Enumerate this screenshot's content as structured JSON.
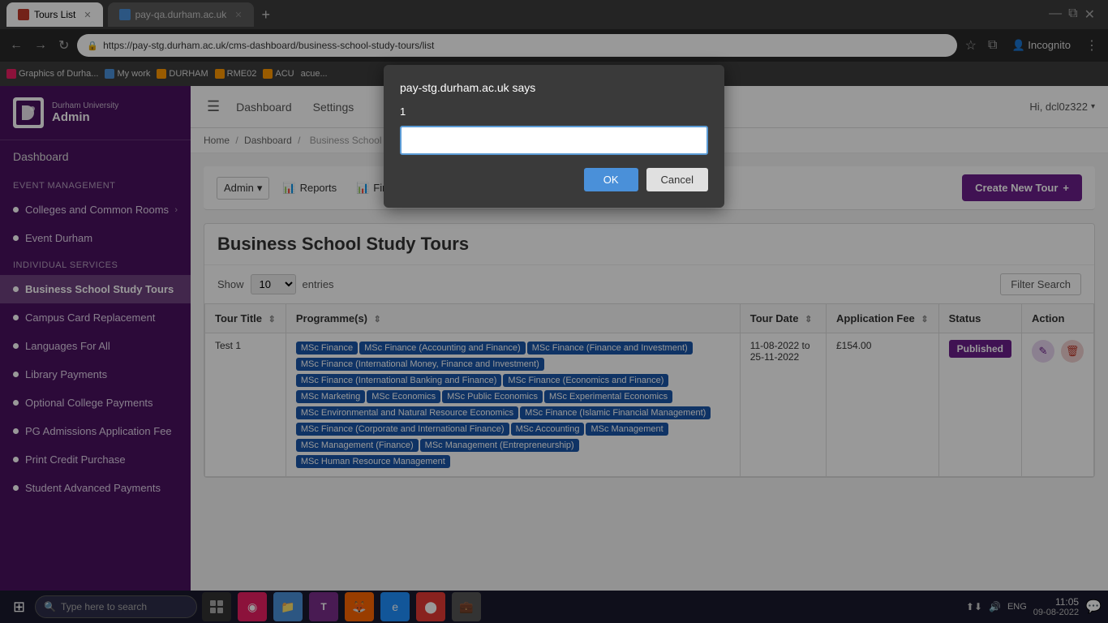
{
  "browser": {
    "tabs": [
      {
        "label": "Tours List",
        "url": "",
        "active": true,
        "favicon_color": "#c0392b"
      },
      {
        "label": "pay-qa.durham.ac.uk",
        "url": "",
        "active": false,
        "favicon_color": "#4a90d9"
      }
    ],
    "address": "https://pay-stg.durham.ac.uk/cms-dashboard/business-school-study-tours/list",
    "bookmarks": [
      {
        "label": "Graphics of Durha...",
        "color": "#e91e63"
      },
      {
        "label": "My work",
        "color": "#4a90d9"
      },
      {
        "label": "DURHAM",
        "color": "#ff9800"
      },
      {
        "label": "RME02",
        "color": "#ff9800"
      },
      {
        "label": "ACU",
        "color": "#ff9800"
      },
      {
        "label": "acue...",
        "color": "#555"
      }
    ],
    "user": "Hi, dcl0z322"
  },
  "sidebar": {
    "logo_text": "Durham University",
    "admin_label": "Admin",
    "dashboard_label": "Dashboard",
    "sections": [
      {
        "header": "EVENT MANAGEMENT",
        "items": [
          {
            "label": "Colleges and Common Rooms",
            "active": false,
            "has_chevron": true
          },
          {
            "label": "Event Durham",
            "active": false,
            "has_chevron": false
          }
        ]
      },
      {
        "header": "INDIVIDUAL SERVICES",
        "items": [
          {
            "label": "Business School Study Tours",
            "active": true,
            "has_chevron": false
          },
          {
            "label": "Campus Card Replacement",
            "active": false,
            "has_chevron": false
          },
          {
            "label": "Languages For All",
            "active": false,
            "has_chevron": false
          },
          {
            "label": "Library Payments",
            "active": false,
            "has_chevron": false
          },
          {
            "label": "Optional College Payments",
            "active": false,
            "has_chevron": false
          },
          {
            "label": "PG Admissions Application Fee",
            "active": false,
            "has_chevron": false
          },
          {
            "label": "Print Credit Purchase",
            "active": false,
            "has_chevron": false
          },
          {
            "label": "Student Advanced Payments",
            "active": false,
            "has_chevron": false
          }
        ]
      }
    ]
  },
  "topbar": {
    "dashboard_label": "Dashboard",
    "settings_label": "Settings",
    "user_label": "Hi, dcl0z322"
  },
  "breadcrumb": {
    "home": "Home",
    "dashboard": "Dashboard",
    "current": "Business School Study Tours"
  },
  "action_bar": {
    "admin_label": "Admin",
    "reports_label": "Reports",
    "financial_label": "Financial Summary Report",
    "create_tour_label": "Create New Tour"
  },
  "table": {
    "title": "Business School Study Tours",
    "show_label": "Show",
    "entries_value": "10",
    "entries_label": "entries",
    "filter_label": "Filter Search",
    "columns": [
      "Tour Title",
      "Programme(s)",
      "Tour Date",
      "Application Fee",
      "Status",
      "Action"
    ],
    "rows": [
      {
        "tour_title": "Test 1",
        "programmes": [
          "MSc Finance",
          "MSc Finance (Accounting and Finance)",
          "MSc Finance (Finance and Investment)",
          "MSc Finance (International Money, Finance and Investment)",
          "MSc Finance (International Banking and Finance)",
          "MSc Finance (Economics and Finance)",
          "MSc Marketing",
          "MSc Economics",
          "MSc Public Economics",
          "MSc Experimental Economics",
          "MSc Environmental and Natural Resource Economics",
          "MSc Finance (Islamic Financial Management)",
          "MSc Finance (Corporate and International Finance)",
          "MSc Accounting",
          "MSc Management",
          "MSc Management (Finance)",
          "MSc Management (Entrepreneurship)",
          "MSc Human Resource Management"
        ],
        "tour_date": "11-08-2022 to 25-11-2022",
        "application_fee": "£154.00",
        "status": "Published"
      }
    ]
  },
  "modal": {
    "title": "pay-stg.durham.ac.uk says",
    "number": "1",
    "input_value": "",
    "ok_label": "OK",
    "cancel_label": "Cancel"
  },
  "taskbar": {
    "search_placeholder": "Type here to search",
    "time": "11:05",
    "date": "09-08-2022",
    "language": "ENG"
  }
}
